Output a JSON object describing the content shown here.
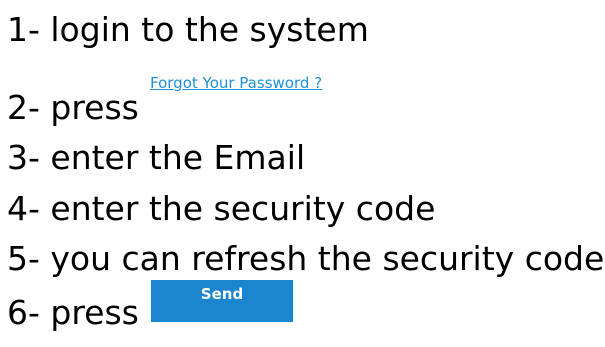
{
  "steps": [
    {
      "text": "1- login to the system"
    },
    {
      "text": "2- press"
    },
    {
      "text": "3- enter the Email"
    },
    {
      "text": "4- enter the security code"
    },
    {
      "text": "5- you can refresh the security code"
    },
    {
      "text": "6- press"
    }
  ],
  "forgot_link": {
    "label": "Forgot Your Password ?",
    "color": "#1f8fd6"
  },
  "send_button": {
    "label": "Send",
    "color": "#1b86cf"
  }
}
